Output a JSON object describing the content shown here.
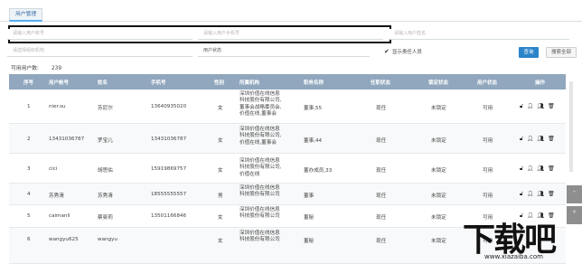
{
  "tab": {
    "label": "用户管理"
  },
  "filters": {
    "account_placeholder": "请输入用户帐号",
    "phone_placeholder": "请输入用户手机号",
    "name_placeholder": "请输入用户姓名",
    "org_placeholder": "请选择组织机构",
    "status_select": "用户状态",
    "show_responsible_label": "显示责任人员",
    "query_label": "查询",
    "reset_label": "搜索全部"
  },
  "count": {
    "label": "可用用户数:",
    "value": "239"
  },
  "table": {
    "headers": [
      "序号",
      "用户帐号",
      "姓名",
      "手机号",
      "性别",
      "所属机构",
      "职务名称",
      "任职状态",
      "锁定状态",
      "用户状态",
      "操作"
    ],
    "rows": [
      {
        "no": "1",
        "account": "nier.su",
        "name": "苏尼尔",
        "phone": "13640935020",
        "gender": "女",
        "org": "深圳价值在线信息科技股份有限公司,董事会战略委员会,价值在线,董事会",
        "title": "董事,55",
        "job_status": "现任",
        "lock": "未锁定",
        "user_status": "可用"
      },
      {
        "no": "2",
        "account": "13431036787",
        "name": "罗宝儿",
        "phone": "13431036787",
        "gender": "女",
        "org": "深圳价值在线信息科技股份有限公司,价值在线,董事会",
        "title": "董事,44",
        "job_status": "现任",
        "lock": "未锁定",
        "user_status": "可用"
      },
      {
        "no": "3",
        "account": "cici",
        "name": "胡思佑",
        "phone": "15919869757",
        "gender": "女",
        "org": "深圳价值在线信息科技股份有限公司,价值在线",
        "title": "董办成员,33",
        "job_status": "现任",
        "lock": "未锁定",
        "user_status": "可用"
      },
      {
        "no": "4",
        "account": "苏秀清",
        "name": "苏秀清",
        "phone": "18555555557",
        "gender": "男",
        "org": "深圳价值在线信息科技股份有限公司",
        "title": "董事",
        "job_status": "现任",
        "lock": "未锁定",
        "user_status": "可用"
      },
      {
        "no": "5",
        "account": "caimanli",
        "name": "蔡曼莉",
        "phone": "13501166846",
        "gender": "女",
        "org": "深圳价值在线信息科技股份有限公司",
        "title": "董秘",
        "job_status": "现任",
        "lock": "未锁定",
        "user_status": "可用"
      },
      {
        "no": "6",
        "account": "wangyu625",
        "name": "wangyu",
        "phone": "",
        "gender": "女",
        "org": "深圳价值在线信息科技股份有限公司",
        "title": "董秘",
        "job_status": "现任",
        "lock": "未锁定",
        "user_status": "可用"
      }
    ]
  },
  "watermark": {
    "big": "下载吧",
    "small": "www.xiazaiba.com"
  }
}
